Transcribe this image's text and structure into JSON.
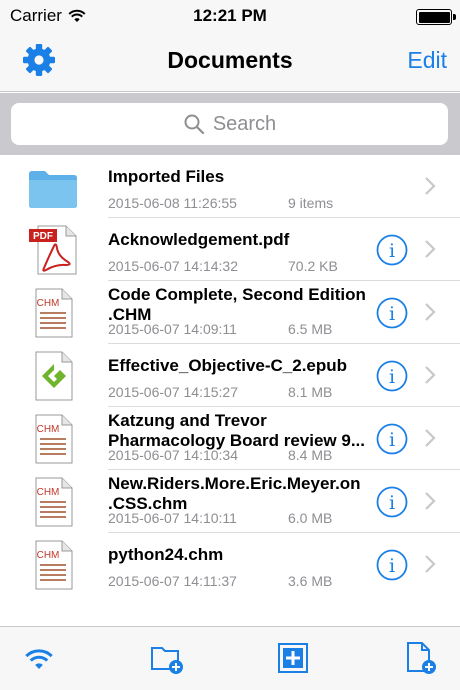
{
  "status_bar": {
    "carrier": "Carrier",
    "time": "12:21 PM"
  },
  "nav": {
    "title": "Documents",
    "edit_label": "Edit"
  },
  "search": {
    "placeholder": "Search"
  },
  "files": [
    {
      "type": "folder",
      "name": "Imported Files",
      "date": "2015-06-08 11:26:55",
      "meta": "9 items",
      "has_info": false
    },
    {
      "type": "pdf",
      "name": "Acknowledgement.pdf",
      "date": "2015-06-07 14:14:32",
      "meta": "70.2 KB",
      "has_info": true
    },
    {
      "type": "chm",
      "name": "Code Complete, Second Edition .CHM",
      "date": "2015-06-07 14:09:11",
      "meta": "6.5 MB",
      "has_info": true
    },
    {
      "type": "epub",
      "name": "Effective_Objective-C_2.epub",
      "date": "2015-06-07 14:15:27",
      "meta": "8.1 MB",
      "has_info": true
    },
    {
      "type": "chm",
      "name": "Katzung and Trevor Pharmacology Board review 9...",
      "date": "2015-06-07 14:10:34",
      "meta": "8.4 MB",
      "has_info": true
    },
    {
      "type": "chm",
      "name": "New.Riders.More.Eric.Meyer.on .CSS.chm",
      "date": "2015-06-07 14:10:11",
      "meta": "6.0 MB",
      "has_info": true
    },
    {
      "type": "chm",
      "name": "python24.chm",
      "date": "2015-06-07 14:11:37",
      "meta": "3.6 MB",
      "has_info": true
    }
  ],
  "icons": {
    "pdf_label": "PDF",
    "chm_label": "CHM"
  },
  "tab_bar": [
    {
      "icon": "wifi-icon"
    },
    {
      "icon": "new-folder-icon"
    },
    {
      "icon": "add-box-icon"
    },
    {
      "icon": "new-file-icon"
    }
  ],
  "colors": {
    "accent": "#1a80e6",
    "folder": "#7cc4f0",
    "pdf_red": "#c9211e",
    "epub_green": "#6fb52c",
    "chm_red": "#c0392b"
  }
}
